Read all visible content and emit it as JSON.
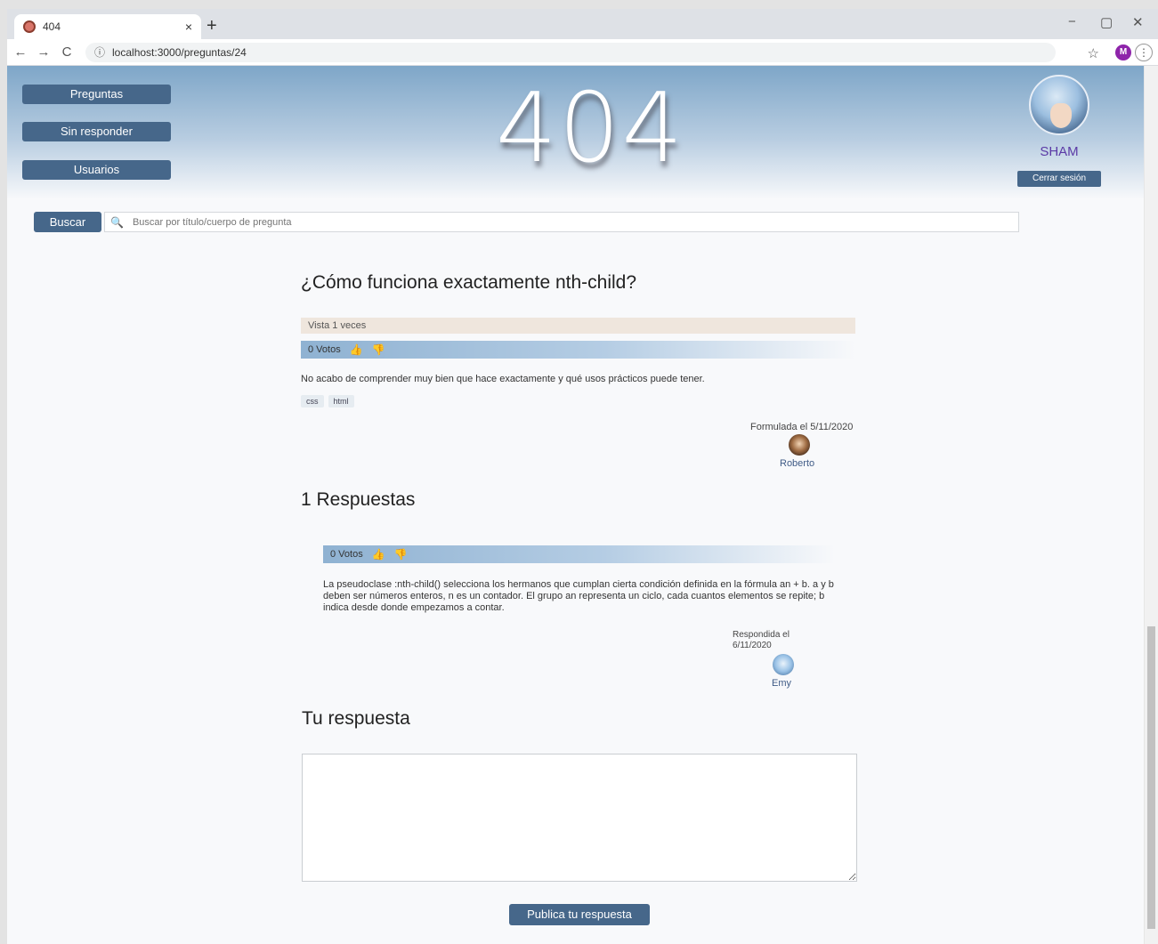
{
  "browser": {
    "tab_title": "404",
    "tab_close": "×",
    "new_tab": "+",
    "minimize": "−",
    "restore": "▢",
    "close": "✕",
    "back": "←",
    "forward": "→",
    "reload": "C",
    "info_icon": "ⓘ",
    "url": "localhost:3000/preguntas/24",
    "star": "☆",
    "profile_initial": "M",
    "menu": "⋮"
  },
  "nav": {
    "questions": "Preguntas",
    "unanswered": "Sin responder",
    "users": "Usuarios"
  },
  "header": {
    "logo_text": "404",
    "username": "SHAM",
    "logout": "Cerrar sesión"
  },
  "search": {
    "button": "Buscar",
    "placeholder": "Buscar por título/cuerpo de pregunta"
  },
  "question": {
    "title": "¿Cómo funciona exactamente nth-child?",
    "views": "Vista 1 veces",
    "votes": "0 Votos",
    "body": "No acabo de comprender muy bien que hace exactamente y qué usos prácticos puede tener.",
    "tags": [
      "css",
      "html"
    ],
    "asked": "Formulada el 5/11/2020",
    "author": "Roberto"
  },
  "answers": {
    "heading": "1 Respuestas",
    "items": [
      {
        "votes": "0 Votos",
        "body": "La pseudoclase :nth-child() selecciona los hermanos que cumplan cierta condición definida en la fórmula an + b. a y b deben ser números enteros, n es un contador. El grupo an representa un ciclo, cada cuantos elementos se repite; b indica desde donde empezamos a contar.",
        "answered": "Respondida el 6/11/2020",
        "author": "Emy"
      }
    ]
  },
  "reply": {
    "heading": "Tu respuesta",
    "value": "",
    "submit": "Publica tu respuesta"
  },
  "icons": {
    "thumb_up": "👍",
    "thumb_down": "👎",
    "search": "🔍"
  },
  "colors": {
    "button": "#46678a",
    "username": "#5b3aa6",
    "author": "#3f5b86",
    "views_bg": "#efe6dd"
  }
}
